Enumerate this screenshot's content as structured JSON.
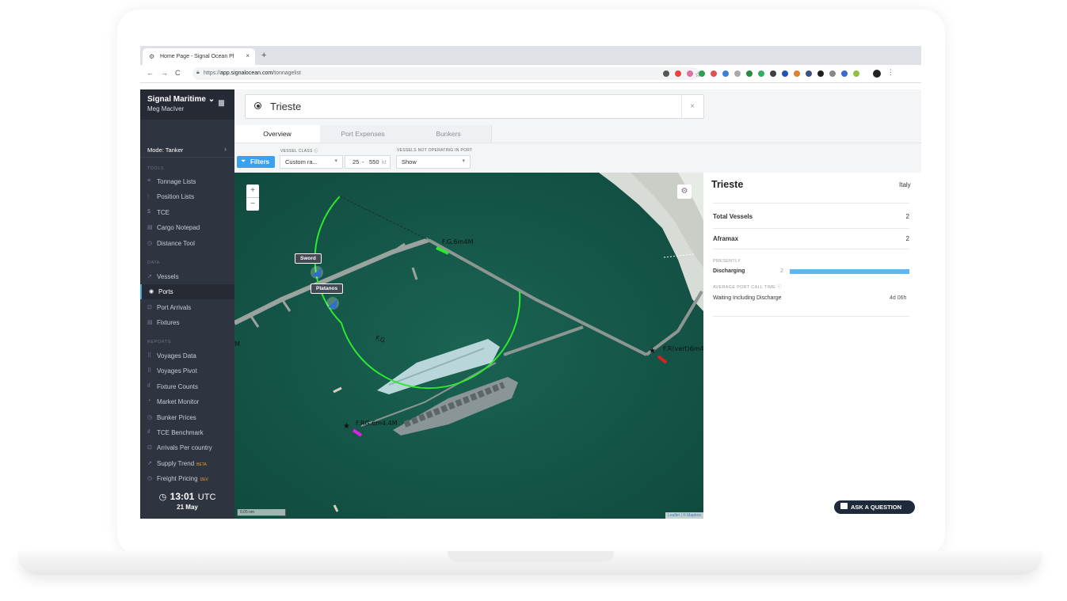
{
  "browser": {
    "tab_title": "Home Page - Signal Ocean Pl",
    "tab_close": "×",
    "new_tab": "+",
    "url_prefix": "https://",
    "url_host": "app.signalocean.com",
    "url_path": "/tonnagelist"
  },
  "sidebar": {
    "brand": "Signal Maritime",
    "user": "Meg MacIver",
    "mode_label": "Mode: Tanker",
    "sections": {
      "tools": "TOOLS",
      "data": "DATA",
      "reports": "REPORTS"
    },
    "tools": [
      {
        "label": "Tonnage Lists",
        "icon": "≡"
      },
      {
        "label": "Position Lists",
        "icon": "⁝"
      },
      {
        "label": "TCE",
        "icon": "$"
      },
      {
        "label": "Cargo Notepad",
        "icon": "▤"
      },
      {
        "label": "Distance Tool",
        "icon": "◷"
      }
    ],
    "data_items": [
      {
        "label": "Vessels",
        "icon": "➚"
      },
      {
        "label": "Ports",
        "icon": "◉"
      },
      {
        "label": "Port Arrivals",
        "icon": "⊡"
      },
      {
        "label": "Fixtures",
        "icon": "▤"
      }
    ],
    "reports": [
      {
        "label": "Voyages Data",
        "icon": "⠿",
        "badge": ""
      },
      {
        "label": "Voyages Pivot",
        "icon": "⠿",
        "badge": ""
      },
      {
        "label": "Fixture Counts",
        "icon": "ıl",
        "badge": ""
      },
      {
        "label": "Market Monitor",
        "icon": "◔",
        "badge": ""
      },
      {
        "label": "Bunker Prices",
        "icon": "◷",
        "badge": ""
      },
      {
        "label": "TCE Benchmark",
        "icon": "ıl",
        "badge": ""
      },
      {
        "label": "Arrivals Per country",
        "icon": "⊡",
        "badge": ""
      },
      {
        "label": "Supply Trend",
        "icon": "↗",
        "badge": "BETA"
      },
      {
        "label": "Freight Pricing",
        "icon": "◷",
        "badge": "DEV"
      }
    ],
    "clock_time": "13:01",
    "clock_zone": "UTC",
    "clock_date": "21 May"
  },
  "search": {
    "value": "Trieste",
    "clear": "×"
  },
  "page_tabs": [
    {
      "label": "Overview"
    },
    {
      "label": "Port Expenses"
    },
    {
      "label": "Bunkers"
    }
  ],
  "filters": {
    "button_label": "Filters",
    "vessel_class_label": "VESSEL CLASS",
    "vessel_class_value": "Custom ra...",
    "range_min": "25",
    "range_dash": "-",
    "range_max": "550",
    "range_unit": "kt",
    "not_operating_label": "VESSELS NOT OPERATING IN PORT",
    "not_operating_value": "Show"
  },
  "map": {
    "zoom_in": "+",
    "zoom_out": "−",
    "vessel_labels": [
      "Sword",
      "Platanos"
    ],
    "marker_labels": [
      "F.G.6m4M",
      "F.R(vert)6m4",
      "F.RG.6m4.4M",
      "F.G",
      "M"
    ],
    "scale_label": "0.05 nm",
    "attribution": "Leaflet | © Mapbox"
  },
  "panel": {
    "title": "Trieste",
    "country": "Italy",
    "total_vessels_label": "Total Vessels",
    "total_vessels_value": "2",
    "aframax_label": "Aframax",
    "aframax_value": "2",
    "presently_label": "PRESENTLY",
    "discharging_label": "Discharging",
    "discharging_count": "2",
    "discharging_fraction": 1.0,
    "avg_port_call_label": "AVERAGE PORT CALL TIME",
    "waiting_label": "Waiting Including Discharge",
    "waiting_value": "4d 06h",
    "ask_label": "ASK A QUESTION"
  },
  "colors": {
    "accent": "#3aa0f0",
    "sidebar_bg": "#2f3441",
    "sea": "#17584a",
    "radius_ring": "#2ee82e",
    "bar_fill": "#62b6ef"
  }
}
